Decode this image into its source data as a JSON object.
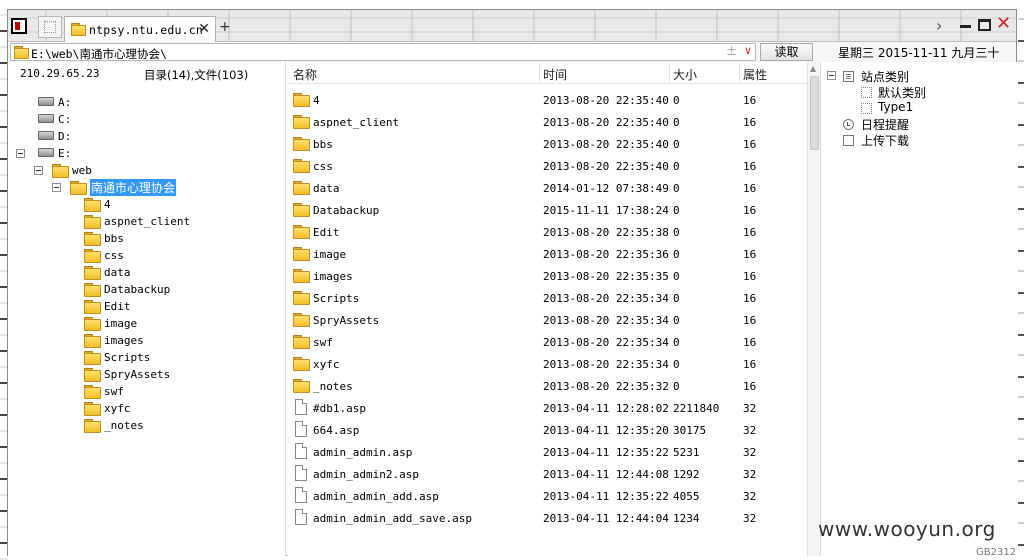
{
  "tab": {
    "title": "ntpsy.ntu.edu.cn"
  },
  "address": {
    "path": "E:\\web\\南通市心理协会\\",
    "read_label": "读取",
    "date": "星期三  2015-11-11  九月三十"
  },
  "left": {
    "ip": "210.29.65.23",
    "count": "目录(14),文件(103)",
    "tree": [
      {
        "label": "A:",
        "type": "drive",
        "expander": false
      },
      {
        "label": "C:",
        "type": "drive",
        "expander": false
      },
      {
        "label": "D:",
        "type": "drive",
        "expander": false
      },
      {
        "label": "E:",
        "type": "drive",
        "expander": true
      },
      {
        "label": "web",
        "type": "folder",
        "expander": true
      },
      {
        "label": "南通市心理协会",
        "type": "folder",
        "expander": true,
        "selected": true
      },
      {
        "label": "4",
        "type": "folder"
      },
      {
        "label": "aspnet_client",
        "type": "folder"
      },
      {
        "label": "bbs",
        "type": "folder"
      },
      {
        "label": "css",
        "type": "folder"
      },
      {
        "label": "data",
        "type": "folder"
      },
      {
        "label": "Databackup",
        "type": "folder"
      },
      {
        "label": "Edit",
        "type": "folder"
      },
      {
        "label": "image",
        "type": "folder"
      },
      {
        "label": "images",
        "type": "folder"
      },
      {
        "label": "Scripts",
        "type": "folder"
      },
      {
        "label": "SpryAssets",
        "type": "folder"
      },
      {
        "label": "swf",
        "type": "folder"
      },
      {
        "label": "xyfc",
        "type": "folder"
      },
      {
        "label": "_notes",
        "type": "folder"
      }
    ]
  },
  "list": {
    "columns": {
      "name": "名称",
      "time": "时间",
      "size": "大小",
      "attr": "属性"
    },
    "rows": [
      {
        "name": "4",
        "time": "2013-08-20 22:35:40",
        "size": "0",
        "attr": "16",
        "type": "folder"
      },
      {
        "name": "aspnet_client",
        "time": "2013-08-20 22:35:40",
        "size": "0",
        "attr": "16",
        "type": "folder"
      },
      {
        "name": "bbs",
        "time": "2013-08-20 22:35:40",
        "size": "0",
        "attr": "16",
        "type": "folder"
      },
      {
        "name": "css",
        "time": "2013-08-20 22:35:40",
        "size": "0",
        "attr": "16",
        "type": "folder"
      },
      {
        "name": "data",
        "time": "2014-01-12 07:38:49",
        "size": "0",
        "attr": "16",
        "type": "folder"
      },
      {
        "name": "Databackup",
        "time": "2015-11-11 17:38:24",
        "size": "0",
        "attr": "16",
        "type": "folder"
      },
      {
        "name": "Edit",
        "time": "2013-08-20 22:35:38",
        "size": "0",
        "attr": "16",
        "type": "folder"
      },
      {
        "name": "image",
        "time": "2013-08-20 22:35:36",
        "size": "0",
        "attr": "16",
        "type": "folder"
      },
      {
        "name": "images",
        "time": "2013-08-20 22:35:35",
        "size": "0",
        "attr": "16",
        "type": "folder"
      },
      {
        "name": "Scripts",
        "time": "2013-08-20 22:35:34",
        "size": "0",
        "attr": "16",
        "type": "folder"
      },
      {
        "name": "SpryAssets",
        "time": "2013-08-20 22:35:34",
        "size": "0",
        "attr": "16",
        "type": "folder"
      },
      {
        "name": "swf",
        "time": "2013-08-20 22:35:34",
        "size": "0",
        "attr": "16",
        "type": "folder"
      },
      {
        "name": "xyfc",
        "time": "2013-08-20 22:35:34",
        "size": "0",
        "attr": "16",
        "type": "folder"
      },
      {
        "name": "_notes",
        "time": "2013-08-20 22:35:32",
        "size": "0",
        "attr": "16",
        "type": "folder"
      },
      {
        "name": "#db1.asp",
        "time": "2013-04-11 12:28:02",
        "size": "2211840",
        "attr": "32",
        "type": "file"
      },
      {
        "name": "664.asp",
        "time": "2013-04-11 12:35:20",
        "size": "30175",
        "attr": "32",
        "type": "file"
      },
      {
        "name": "admin_admin.asp",
        "time": "2013-04-11 12:35:22",
        "size": "5231",
        "attr": "32",
        "type": "file"
      },
      {
        "name": "admin_admin2.asp",
        "time": "2013-04-11 12:44:08",
        "size": "1292",
        "attr": "32",
        "type": "file"
      },
      {
        "name": "admin_admin_add.asp",
        "time": "2013-04-11 12:35:22",
        "size": "4055",
        "attr": "32",
        "type": "file"
      },
      {
        "name": "admin_admin_add_save.asp",
        "time": "2013-04-11 12:44:04",
        "size": "1234",
        "attr": "32",
        "type": "file"
      }
    ]
  },
  "right": {
    "items": [
      {
        "label": "站点类别",
        "icon": "grid-icon",
        "expander": true
      },
      {
        "label": "默认类别",
        "icon": "category-icon",
        "child": true
      },
      {
        "label": "Type1",
        "icon": "category-icon",
        "child": true
      },
      {
        "label": "日程提醒",
        "icon": "clock-icon"
      },
      {
        "label": "上传下载",
        "icon": "blank-icon"
      }
    ]
  },
  "watermark": "www.wooyun.org",
  "gb": "GB2312"
}
